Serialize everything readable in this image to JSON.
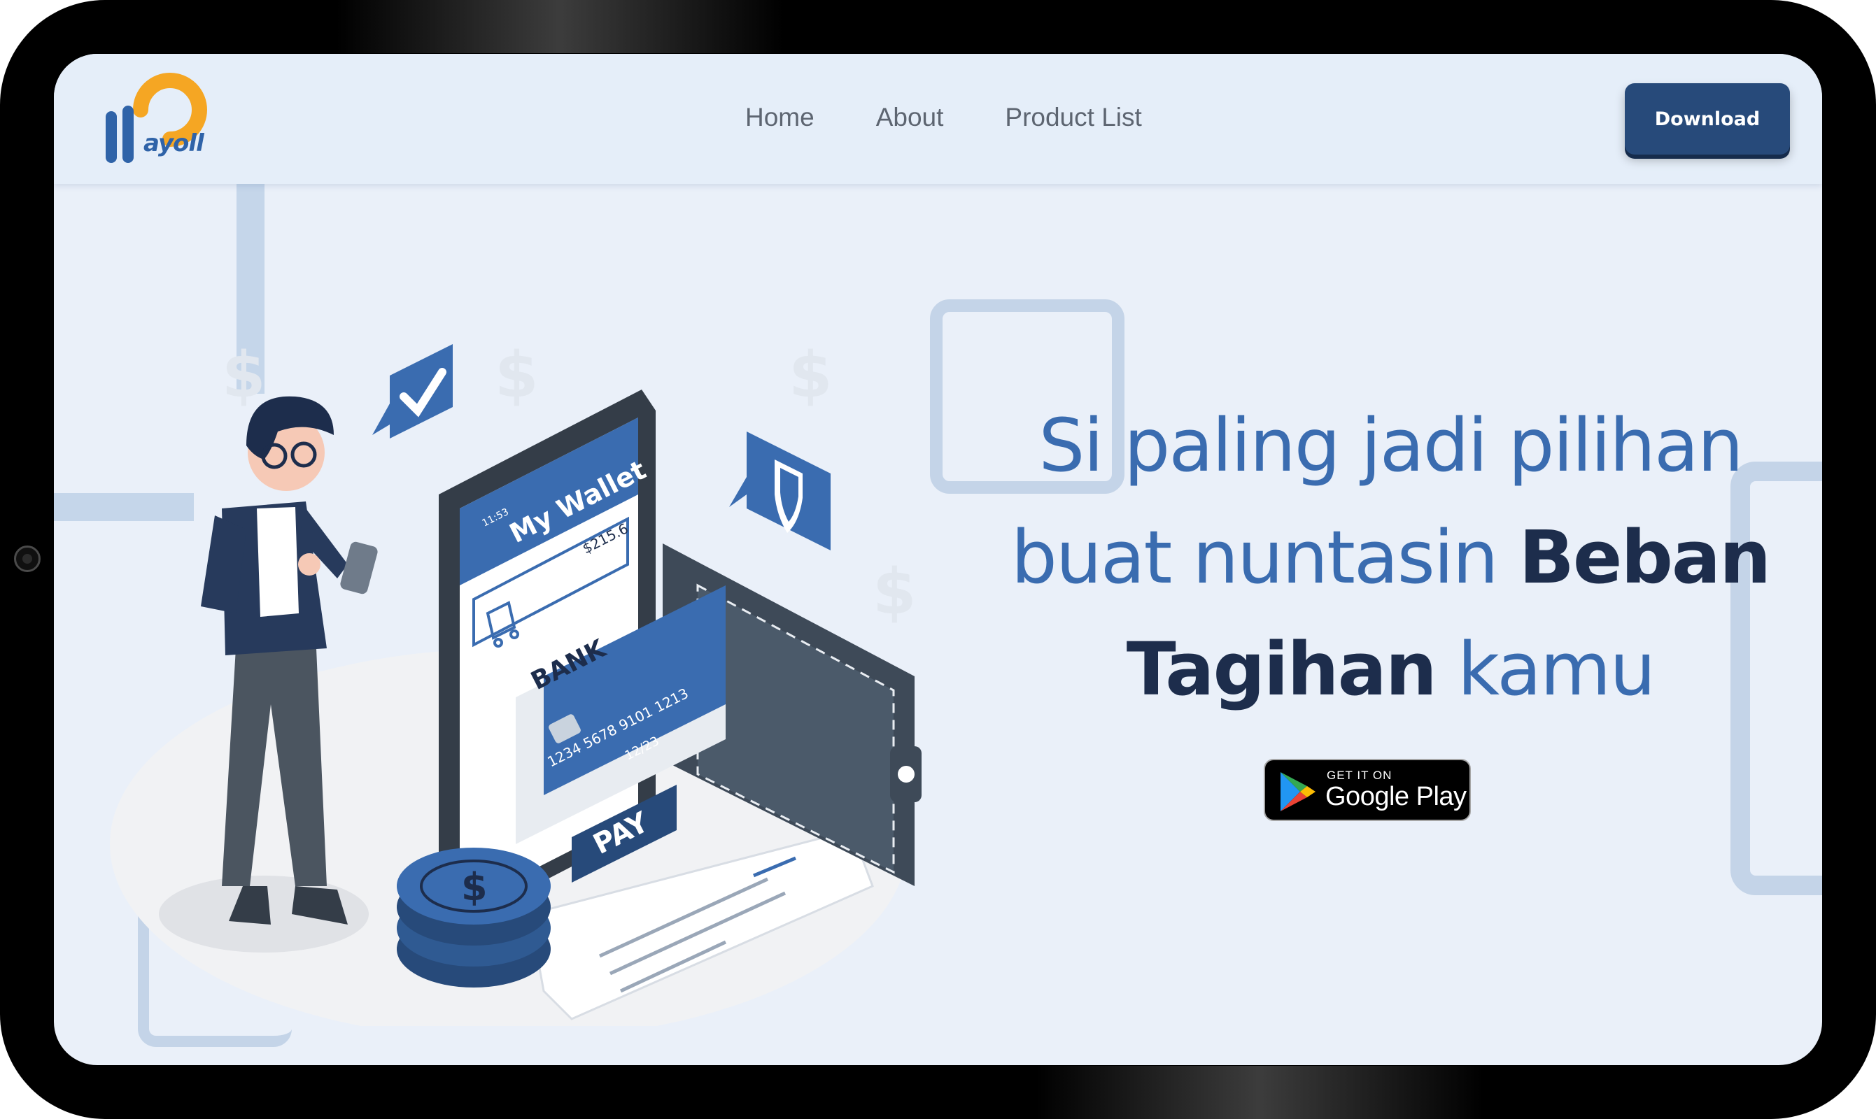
{
  "brand": {
    "logo_text": "ayoll",
    "colors": {
      "orange": "#f5a623",
      "blue": "#2f63a8",
      "dark_navy": "#1d2d4c",
      "button": "#274a7a"
    }
  },
  "nav": {
    "items": [
      {
        "label": "Home"
      },
      {
        "label": "About"
      },
      {
        "label": "Product List"
      }
    ]
  },
  "header": {
    "download_label": "Download"
  },
  "hero": {
    "line1": "Si paling jadi pilihan",
    "line2_regular": "buat nuntasin ",
    "line2_strong": "Beban",
    "line3_strong": "Tagihan",
    "line3_regular": " kamu"
  },
  "illustration": {
    "phone_title": "My Wallet",
    "phone_time": "11:53",
    "phone_amount": "$215.6",
    "card_bank": "BANK",
    "card_number": "1234 5678 9101 1213",
    "card_expiry": "12/23",
    "pay_label": "PAY",
    "coin_symbol": "$"
  },
  "store_badge": {
    "small_text": "GET IT ON",
    "big_text": "Google Play"
  }
}
